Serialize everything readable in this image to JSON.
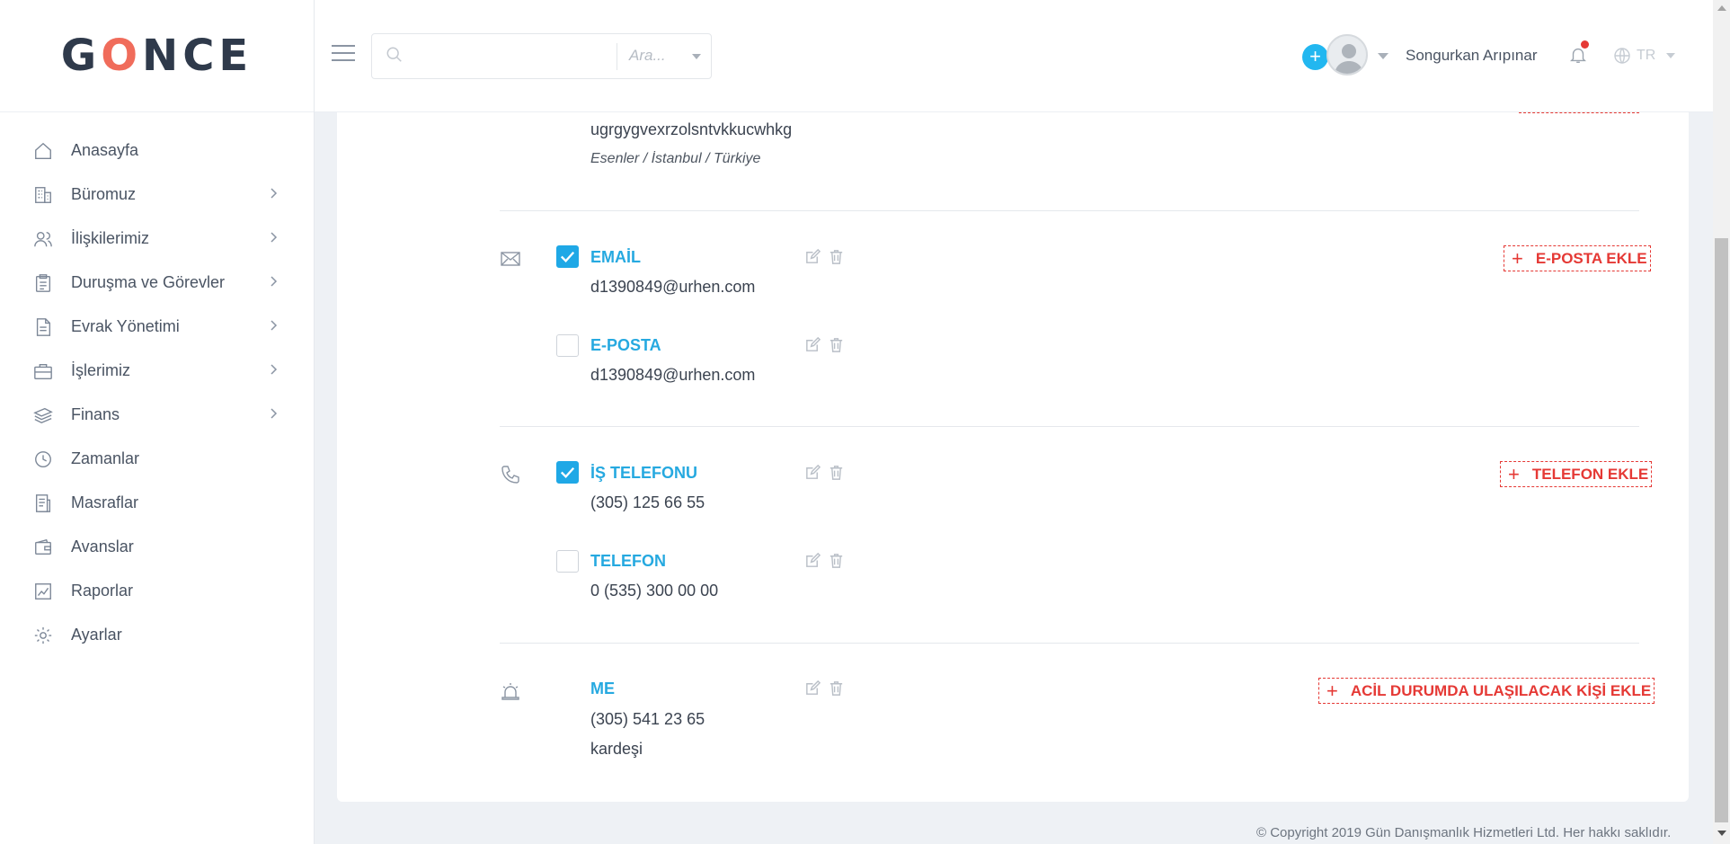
{
  "brand": {
    "logo_prefix": "G",
    "logo_o": "O",
    "logo_suffix": "NCE"
  },
  "sidebar": {
    "items": [
      {
        "label": "Anasayfa",
        "icon": "home-icon",
        "has_children": false
      },
      {
        "label": "Büromuz",
        "icon": "building-icon",
        "has_children": true
      },
      {
        "label": "İlişkilerimiz",
        "icon": "users-icon",
        "has_children": true
      },
      {
        "label": "Duruşma ve Görevler",
        "icon": "clipboard-icon",
        "has_children": true
      },
      {
        "label": "Evrak Yönetimi",
        "icon": "document-icon",
        "has_children": true
      },
      {
        "label": "İşlerimiz",
        "icon": "briefcase-icon",
        "has_children": true
      },
      {
        "label": "Finans",
        "icon": "money-icon",
        "has_children": true
      },
      {
        "label": "Zamanlar",
        "icon": "clock-icon",
        "has_children": false
      },
      {
        "label": "Masraflar",
        "icon": "receipt-icon",
        "has_children": false
      },
      {
        "label": "Avanslar",
        "icon": "wallet-icon",
        "has_children": false
      },
      {
        "label": "Raporlar",
        "icon": "chart-icon",
        "has_children": false
      },
      {
        "label": "Ayarlar",
        "icon": "gear-icon",
        "has_children": false
      }
    ]
  },
  "header": {
    "search": {
      "value": "",
      "placeholder": "",
      "filter_label": "Ara..."
    },
    "add_label": "+",
    "user_name": "Songurkan Arıpınar",
    "language": "TR"
  },
  "address": {
    "line": "ugrgygvexrzolsntvkkucwhkg",
    "place": "Esenler / İstanbul / Türkiye"
  },
  "emails": {
    "add_label": "E-POSTA EKLE",
    "entries": [
      {
        "title": "EMAİL",
        "value": "d1390849@urhen.com",
        "primary": true
      },
      {
        "title": "E-POSTA",
        "value": "d1390849@urhen.com",
        "primary": false
      }
    ]
  },
  "phones": {
    "add_label": "TELEFON EKLE",
    "entries": [
      {
        "title": "İŞ TELEFONU",
        "value": "(305) 125 66 55",
        "primary": true
      },
      {
        "title": "TELEFON",
        "value": "0 (535) 300 00 00",
        "primary": false
      }
    ]
  },
  "emergency": {
    "add_label": "ACİL DURUMDA ULAŞILACAK KİŞİ EKLE",
    "entries": [
      {
        "title": "ME",
        "phone": "(305) 541 23 65",
        "relation": "kardeşi"
      }
    ]
  },
  "footer": {
    "copyright": "© Copyright 2019 Gün Danışmanlık Hizmetleri Ltd. Her hakkı saklıdır."
  },
  "colors": {
    "accent": "#26a9e0",
    "danger": "#e53935",
    "logo_o": "#f06c5b",
    "logo_text": "#2f3a4b"
  }
}
